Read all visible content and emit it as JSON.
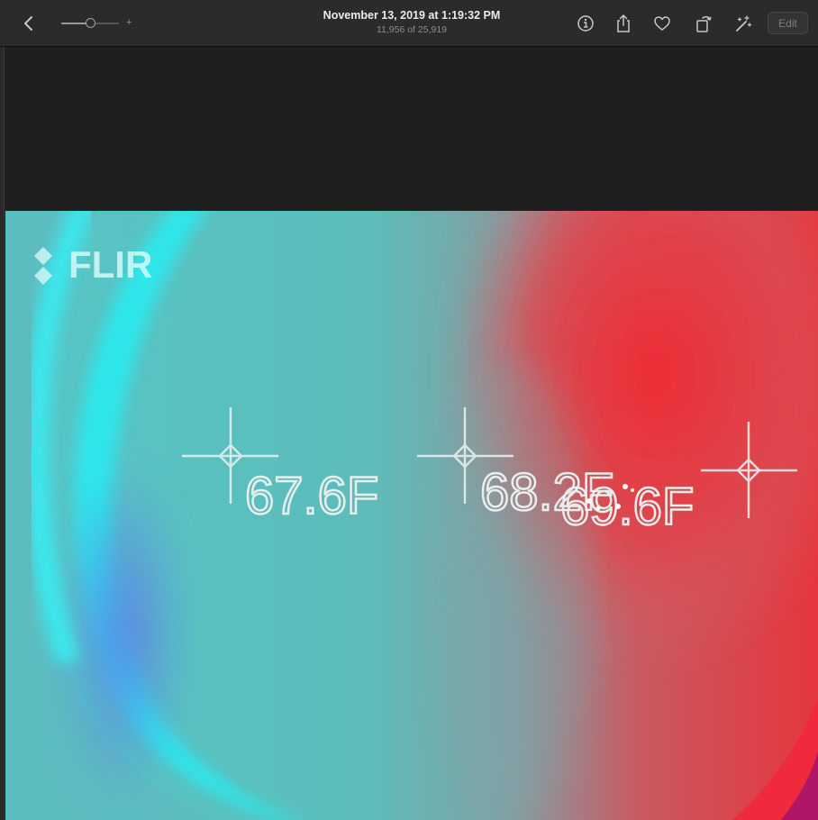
{
  "toolbar": {
    "title": "November 13, 2019 at 1:19:32 PM",
    "subtitle": "11,956 of 25,919",
    "zoom_plus": "+",
    "edit_label": "Edit",
    "zoom_level": 0.5,
    "icons": [
      "chevron-left-icon",
      "info-icon",
      "share-icon",
      "heart-icon",
      "rotate-icon",
      "magic-wand-icon"
    ]
  },
  "photo": {
    "logo_text": "FLIR",
    "readings": [
      "67.6F",
      "68.2F",
      "69.6F"
    ],
    "colors": {
      "cold": "#2fe6ea",
      "blue": "#5a8ee6",
      "mid": "#5fb3b0",
      "hot": "#e8343c",
      "magenta": "#b01666"
    }
  }
}
